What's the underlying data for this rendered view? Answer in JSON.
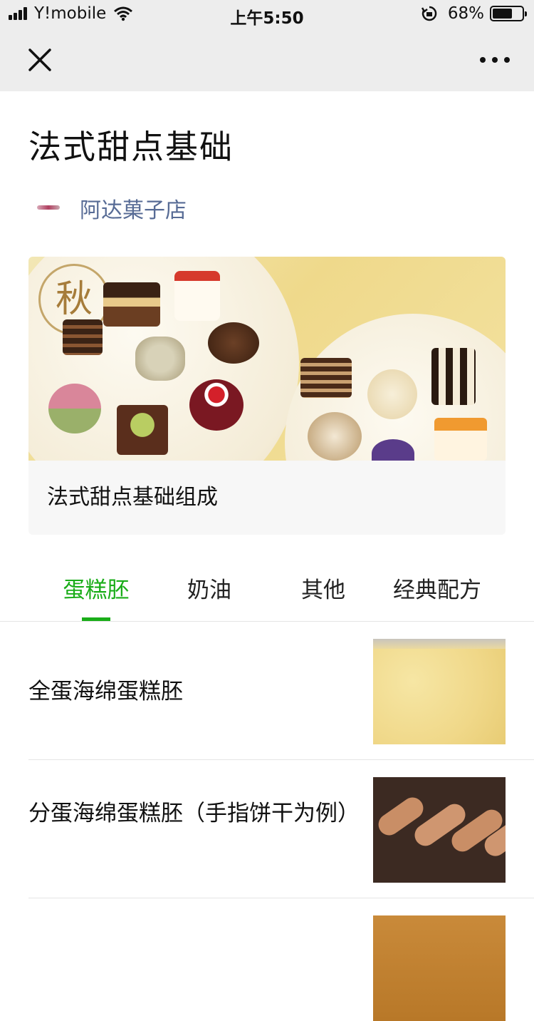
{
  "status_bar": {
    "carrier": "Y!mobile",
    "time": "上午5:50",
    "battery_percent": "68%",
    "battery_level": 0.68
  },
  "nav": {
    "close_icon": "close-icon",
    "more_icon": "more-icon"
  },
  "article": {
    "title": "法式甜点基础",
    "author": "阿达菓子店"
  },
  "card": {
    "image_text": "秋",
    "caption": "法式甜点基础组成"
  },
  "tabs": [
    {
      "label": "蛋糕胚",
      "active": true
    },
    {
      "label": "奶油",
      "active": false
    },
    {
      "label": "其他",
      "active": false
    },
    {
      "label": "经典配方",
      "active": false
    }
  ],
  "list": [
    {
      "title": "全蛋海绵蛋糕胚"
    },
    {
      "title": "分蛋海绵蛋糕胚（手指饼干为例）"
    },
    {
      "title": ""
    }
  ],
  "colors": {
    "accent": "#1aad19",
    "link": "#576b95",
    "nav_bg": "#ededed"
  }
}
